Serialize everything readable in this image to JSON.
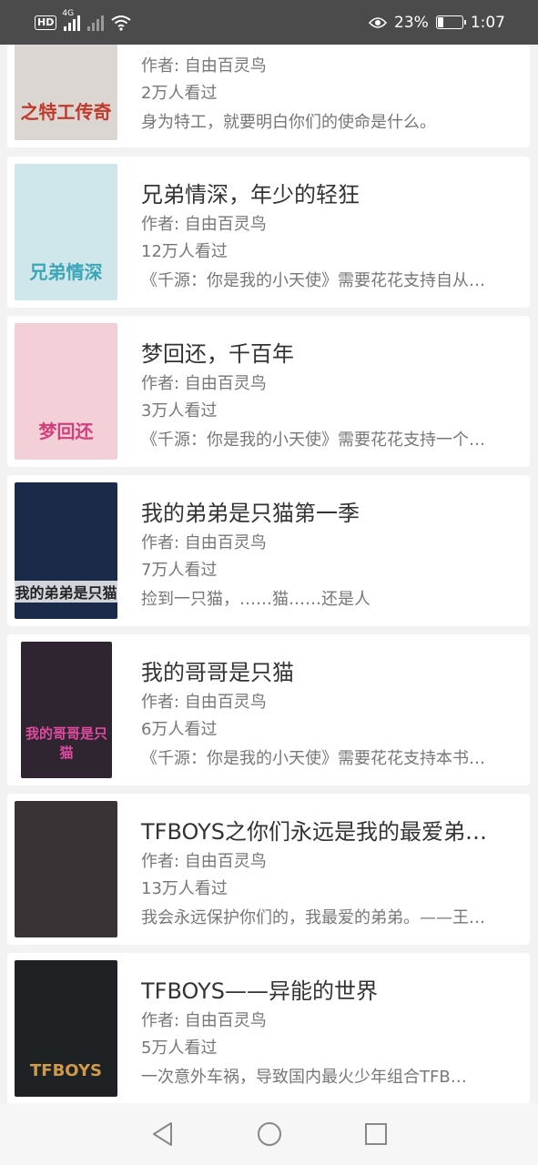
{
  "status_bar": {
    "hd": "HD",
    "network": "4G",
    "battery": "23%",
    "time": "1:07"
  },
  "books": [
    {
      "title": "",
      "author": "作者: 自由百灵鸟",
      "views": "2万人看过",
      "desc": "身为特工，就要明白你们的使命是什么。",
      "cover_text": "之特工传奇",
      "cover_bg": "#dcd6d2"
    },
    {
      "title": "兄弟情深，年少的轻狂",
      "author": "作者: 自由百灵鸟",
      "views": "12万人看过",
      "desc": "《千源：你是我的小天使》需要花花支持自从…",
      "cover_text": "兄弟情深",
      "cover_bg": "#cfe6ea"
    },
    {
      "title": "梦回还，千百年",
      "author": "作者: 自由百灵鸟",
      "views": "3万人看过",
      "desc": "《千源：你是我的小天使》需要花花支持一个…",
      "cover_text": "梦回还",
      "cover_bg": "#f3cfd8"
    },
    {
      "title": "我的弟弟是只猫第一季",
      "author": "作者: 自由百灵鸟",
      "views": "7万人看过",
      "desc": "捡到一只猫，……猫……还是人",
      "cover_text": "我的弟弟是只猫",
      "cover_bg": "#1c2a4a"
    },
    {
      "title": "我的哥哥是只猫",
      "author": "作者: 自由百灵鸟",
      "views": "6万人看过",
      "desc": "《千源：你是我的小天使》需要花花支持本书…",
      "cover_text": "我的哥哥是只猫",
      "cover_bg": "#2f2530"
    },
    {
      "title": "TFBOYS之你们永远是我的最爱弟…",
      "author": "作者: 自由百灵鸟",
      "views": "13万人看过",
      "desc": "我会永远保护你们的，我最爱的弟弟。——王…",
      "cover_text": "",
      "cover_bg": "#3a3336"
    },
    {
      "title": "TFBOYS——异能的世界",
      "author": "作者: 自由百灵鸟",
      "views": "5万人看过",
      "desc": "一次意外车祸，导致国内最火少年组合TFB…",
      "cover_text": "TFBOYS",
      "cover_bg": "#1e2224"
    }
  ],
  "nav": {
    "back": "back-icon",
    "home": "home-icon",
    "recents": "recents-icon"
  }
}
